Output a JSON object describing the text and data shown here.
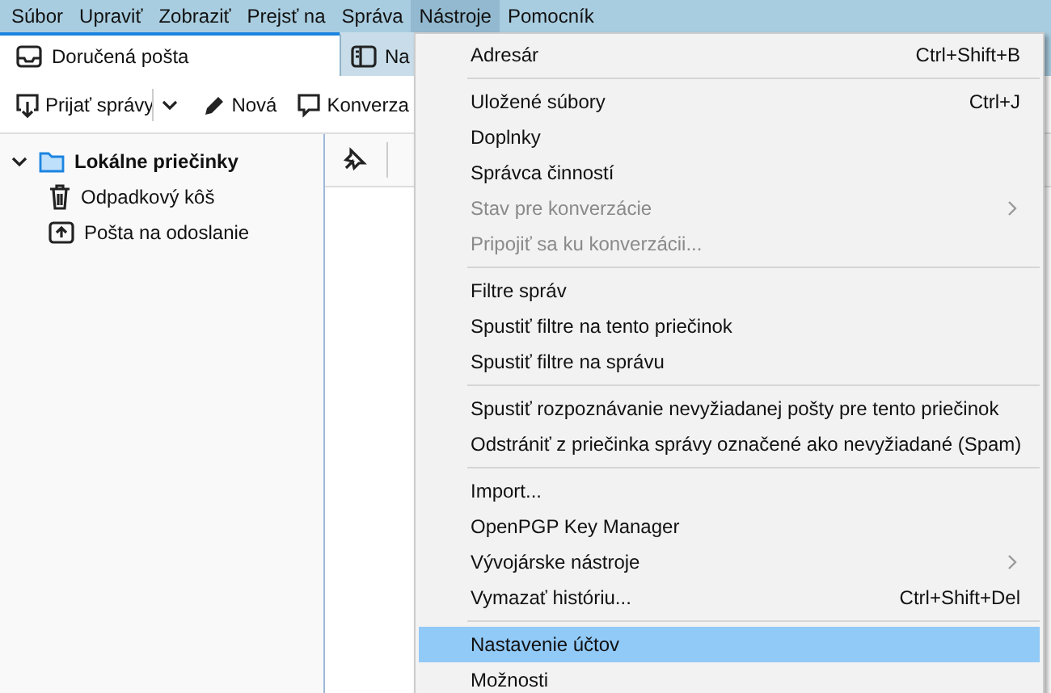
{
  "menubar": [
    {
      "label": "Súbor",
      "selected": false
    },
    {
      "label": "Upraviť",
      "selected": false
    },
    {
      "label": "Zobraziť",
      "selected": false
    },
    {
      "label": "Prejsť na",
      "selected": false
    },
    {
      "label": "Správa",
      "selected": false
    },
    {
      "label": "Nástroje",
      "selected": true
    },
    {
      "label": "Pomocník",
      "selected": false
    }
  ],
  "tabs": [
    {
      "label": "Doručená pošta",
      "kind": "inbox",
      "selected": true
    },
    {
      "label": "Na",
      "kind": "layout",
      "selected": false
    }
  ],
  "toolbar": [
    {
      "label": "Prijať správy",
      "kind": "get",
      "dropdown": true
    },
    {
      "label": "Nová",
      "kind": "write",
      "dropdown": false
    },
    {
      "label": "Konverza",
      "kind": "chat",
      "dropdown": false
    }
  ],
  "folders": [
    {
      "label": "Lokálne priečinky",
      "kind": "folder",
      "expanded": true,
      "children": [
        {
          "label": "Odpadkový kôš",
          "kind": "trash"
        },
        {
          "label": "Pošta na odoslanie",
          "kind": "outbox"
        }
      ]
    }
  ],
  "menu": {
    "groups": [
      [
        {
          "label": "Adresár",
          "shortcut": "Ctrl+Shift+B",
          "disabled": false,
          "submenu": false,
          "selected": false
        }
      ],
      [
        {
          "label": "Uložené súbory",
          "shortcut": "Ctrl+J",
          "disabled": false,
          "submenu": false,
          "selected": false
        },
        {
          "label": "Doplnky",
          "disabled": false,
          "submenu": false,
          "selected": false
        },
        {
          "label": "Správca činností",
          "disabled": false,
          "submenu": false,
          "selected": false
        },
        {
          "label": "Stav pre konverzácie",
          "disabled": true,
          "submenu": true,
          "selected": false
        },
        {
          "label": "Pripojiť sa ku konverzácii...",
          "disabled": true,
          "submenu": false,
          "selected": false
        }
      ],
      [
        {
          "label": "Filtre správ",
          "disabled": false,
          "submenu": false,
          "selected": false
        },
        {
          "label": "Spustiť filtre na tento priečinok",
          "disabled": false,
          "submenu": false,
          "selected": false
        },
        {
          "label": "Spustiť filtre na správu",
          "disabled": false,
          "submenu": false,
          "selected": false
        }
      ],
      [
        {
          "label": "Spustiť rozpoznávanie nevyžiadanej pošty pre tento priečinok",
          "disabled": false,
          "submenu": false,
          "selected": false
        },
        {
          "label": "Odstrániť z priečinka správy označené ako nevyžiadané (Spam)",
          "disabled": false,
          "submenu": false,
          "selected": false
        }
      ],
      [
        {
          "label": "Import...",
          "disabled": false,
          "submenu": false,
          "selected": false
        },
        {
          "label": "OpenPGP Key Manager",
          "disabled": false,
          "submenu": false,
          "selected": false
        },
        {
          "label": "Vývojárske nástroje",
          "disabled": false,
          "submenu": true,
          "selected": false
        },
        {
          "label": "Vymazať históriu...",
          "shortcut": "Ctrl+Shift+Del",
          "disabled": false,
          "submenu": false,
          "selected": false
        }
      ],
      [
        {
          "label": "Nastavenie účtov",
          "disabled": false,
          "submenu": false,
          "selected": true
        },
        {
          "label": "Možnosti",
          "disabled": false,
          "submenu": false,
          "selected": false
        }
      ]
    ]
  }
}
